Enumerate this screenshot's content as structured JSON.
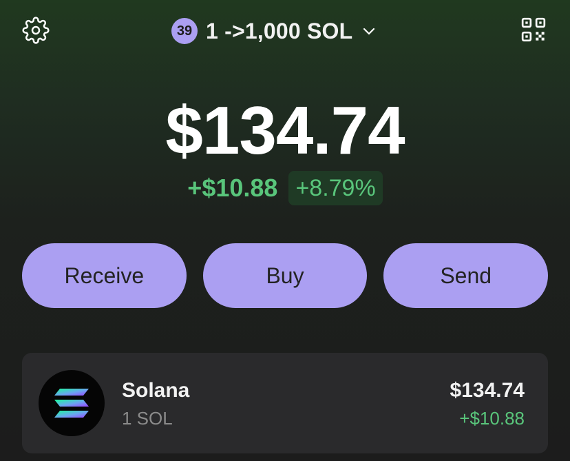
{
  "header": {
    "account_badge": "39",
    "account_name": "1 ->1,000 SOL",
    "settings_icon": "gear-icon",
    "dropdown_icon": "chevron-down-icon",
    "scan_icon": "qr-code-icon"
  },
  "portfolio": {
    "balance": "$134.74",
    "change_amount": "+$10.88",
    "change_percent": "+8.79%"
  },
  "actions": {
    "receive_label": "Receive",
    "buy_label": "Buy",
    "send_label": "Send"
  },
  "tokens": [
    {
      "name": "Solana",
      "quantity": "1 SOL",
      "value": "$134.74",
      "change": "+$10.88",
      "icon": "solana-logo-icon"
    }
  ],
  "colors": {
    "accent": "#ab9ff2",
    "positive": "#59c57b",
    "card": "#2a2a2c",
    "background_top": "#20391f",
    "background_bottom": "#1c1c1c"
  }
}
